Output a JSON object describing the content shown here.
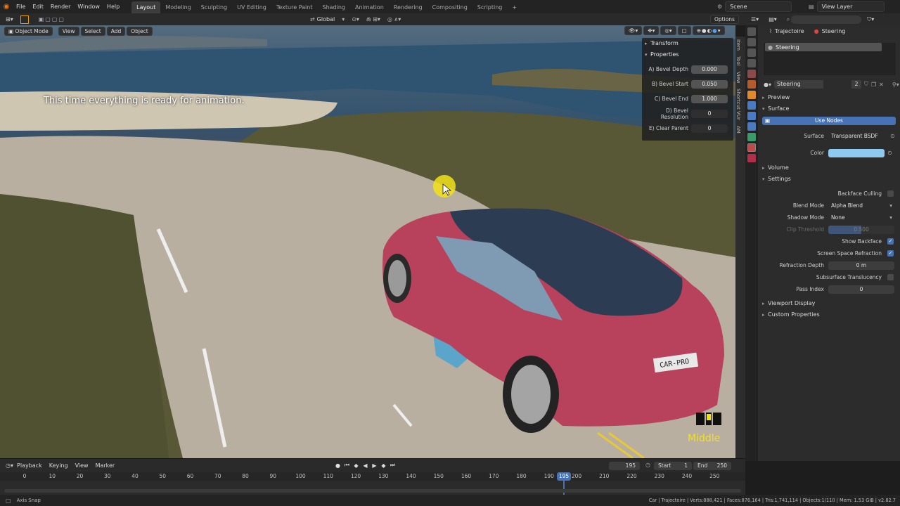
{
  "top_menu": {
    "items": [
      "File",
      "Edit",
      "Render",
      "Window",
      "Help"
    ],
    "workspaces": [
      "Layout",
      "Modeling",
      "Sculpting",
      "UV Editing",
      "Texture Paint",
      "Shading",
      "Animation",
      "Rendering",
      "Compositing",
      "Scripting"
    ],
    "active_workspace": "Layout",
    "add_tab": "+",
    "scene": "Scene",
    "view_layer": "View Layer"
  },
  "toolbar": {
    "orientation": "Global",
    "options": "Options"
  },
  "viewport_header": {
    "mode": "Object Mode",
    "menus": [
      "View",
      "Select",
      "Add",
      "Object"
    ]
  },
  "viewport": {
    "overlay_text": "This time everything is ready for animation.",
    "corner_text": "Middle",
    "plate_text": "CAR-PRO"
  },
  "n_panel": {
    "transform_label": "Transform",
    "properties_label": "Properties",
    "rows": [
      {
        "label": "A) Bevel Depth",
        "value": "0.000"
      },
      {
        "label": "B) Bevel Start",
        "value": "0.050"
      },
      {
        "label": "C) Bevel End",
        "value": "1.000"
      },
      {
        "label": "D) Bevel Resolution",
        "value": "0"
      },
      {
        "label": "E) Clear Parent",
        "value": "0"
      }
    ],
    "side_tabs": [
      "Item",
      "Tool",
      "View",
      "Shortcut VUr",
      "AM"
    ]
  },
  "properties": {
    "breadcrumb_object": "Trajectoire",
    "breadcrumb_material": "Steering",
    "slot": "Steering",
    "material_name": "Steering",
    "user_count": "2",
    "sections": {
      "preview": "Preview",
      "surface": "Surface",
      "volume": "Volume",
      "settings": "Settings",
      "viewport_display": "Viewport Display",
      "custom_properties": "Custom Properties"
    },
    "use_nodes": "Use Nodes",
    "surface_label": "Surface",
    "surface_value": "Transparent BSDF",
    "color_label": "Color",
    "color_hex": "#8ecaf0",
    "settings": [
      {
        "label": "Backface Culling",
        "type": "check",
        "checked": false
      },
      {
        "label": "Blend Mode",
        "type": "drop",
        "value": "Alpha Blend"
      },
      {
        "label": "Shadow Mode",
        "type": "drop",
        "value": "None"
      },
      {
        "label": "Clip Threshold",
        "type": "field",
        "value": "0.500"
      },
      {
        "label": "Show Backface",
        "type": "check",
        "checked": true
      },
      {
        "label": "Screen Space Refraction",
        "type": "check",
        "checked": true
      },
      {
        "label": "Refraction Depth",
        "type": "field",
        "value": "0 m"
      },
      {
        "label": "Subsurface Translucency",
        "type": "check",
        "checked": false
      },
      {
        "label": "Pass Index",
        "type": "field",
        "value": "0"
      }
    ]
  },
  "timeline": {
    "menus": [
      "Playback",
      "Keying",
      "View",
      "Marker"
    ],
    "current_frame": "195",
    "start_label": "Start",
    "start": "1",
    "end_label": "End",
    "end": "250",
    "ticks": [
      "0",
      "10",
      "20",
      "30",
      "40",
      "50",
      "60",
      "70",
      "80",
      "90",
      "100",
      "110",
      "120",
      "130",
      "140",
      "150",
      "160",
      "170",
      "180",
      "190",
      "200",
      "210",
      "220",
      "230",
      "240",
      "250"
    ],
    "playhead": "195"
  },
  "status": {
    "left": "Axis Snap",
    "right": "Car | Trajectoire | Verts:888,421 | Faces:876,164 | Tris:1,741,114 | Objects:1/110 | Mem: 1.53 GiB | v2.82.7"
  }
}
